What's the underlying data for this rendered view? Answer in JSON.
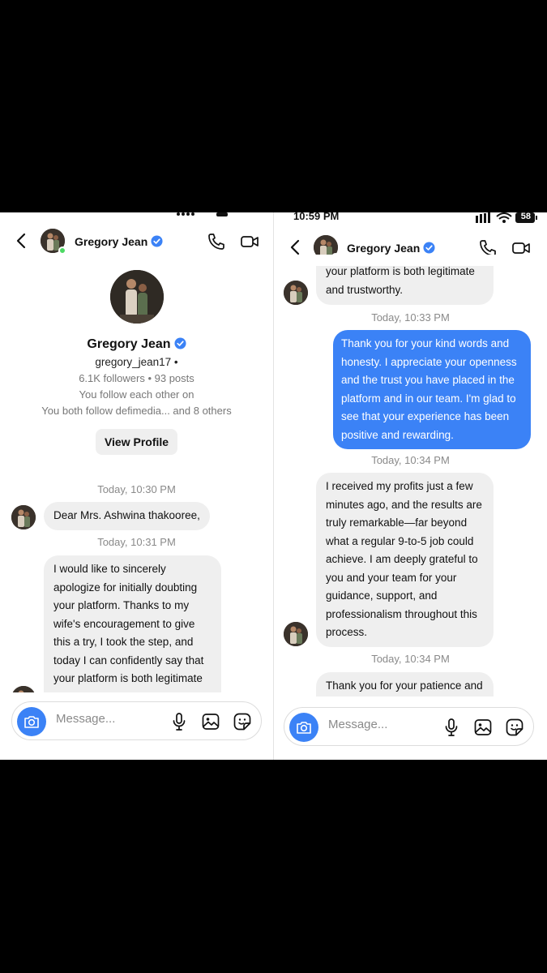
{
  "left": {
    "contact": {
      "name": "Gregory Jean",
      "verified": true
    },
    "profile": {
      "name": "Gregory Jean",
      "handle": "gregory_jean17  •",
      "stats": "6.1K followers • 93 posts",
      "mutual_follow": "You follow each other on",
      "both_follow": "You both follow  defimedia... and  8 others",
      "view_profile_label": "View Profile"
    },
    "timestamps": [
      "Today, 10:30 PM",
      "Today, 10:31 PM"
    ],
    "messages": [
      {
        "direction": "incoming",
        "text": "Dear Mrs. Ashwina thakooree,"
      },
      {
        "direction": "incoming",
        "text": "I would like to sincerely apologize for initially doubting your platform. Thanks to my wife's encouragement to give this a try, I took the step, and today I can confidently say that your platform is both legitimate"
      }
    ],
    "composer": {
      "placeholder": "Message..."
    }
  },
  "right": {
    "status_bar": {
      "time": "10:59 PM",
      "battery": "58"
    },
    "contact": {
      "name": "Gregory Jean",
      "verified": true
    },
    "timestamps": [
      "Today, 10:33 PM",
      "Today, 10:34 PM",
      "Today, 10:34 PM"
    ],
    "messages": [
      {
        "direction": "incoming",
        "text": "your platform is both legitimate and trustworthy."
      },
      {
        "direction": "outgoing",
        "text": "Thank you for your kind words and honesty. I appreciate your openness and the trust you have placed in the platform and in our team. I'm glad to see that your experience has been positive and rewarding."
      },
      {
        "direction": "incoming",
        "text": "I received my profits just a few minutes ago, and the results are truly remarkable—far beyond what a regular 9-to-5 job could achieve. I am deeply grateful to you and your team for your guidance, support, and professionalism throughout this process."
      },
      {
        "direction": "incoming",
        "text": "Thank you for your patience and"
      }
    ],
    "composer": {
      "placeholder": "Message..."
    }
  },
  "colors": {
    "accent": "#3b82f6",
    "online": "#4cd964",
    "bubble_in": "#efefef",
    "verified": "#3b82f6"
  },
  "icons": [
    "back-arrow-icon",
    "verified-badge-icon",
    "phone-icon",
    "video-camera-icon",
    "camera-icon",
    "microphone-icon",
    "gallery-icon",
    "sticker-icon"
  ]
}
